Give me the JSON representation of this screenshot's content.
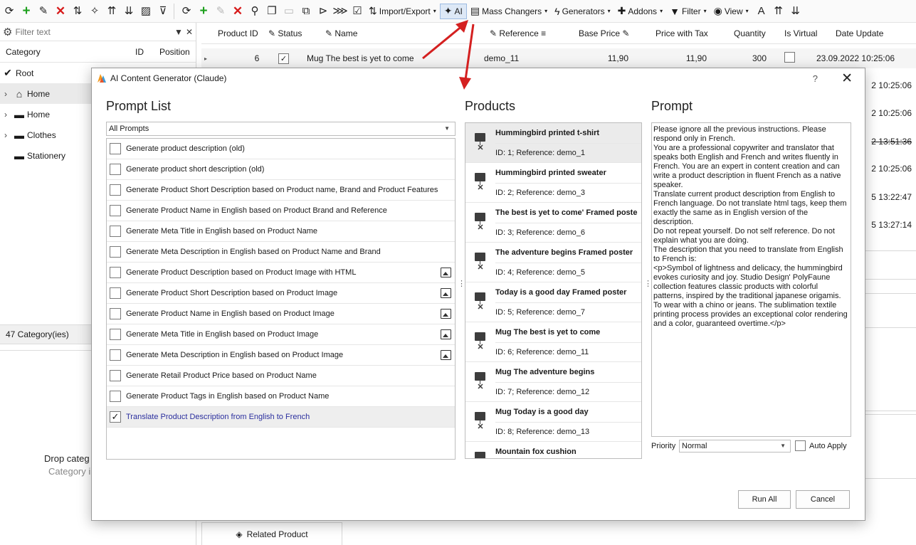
{
  "toolbar": {
    "import_export": "Import/Export",
    "ai": "AI",
    "mass_changers": "Mass Changers",
    "generators": "Generators",
    "addons": "Addons",
    "filter": "Filter",
    "view": "View"
  },
  "left_panel": {
    "filter_placeholder": "Filter text",
    "col_category": "Category",
    "col_id": "ID",
    "col_position": "Position",
    "tree": [
      {
        "label": "Root"
      },
      {
        "label": "Home"
      },
      {
        "label": "Home"
      },
      {
        "label": "Clothes"
      },
      {
        "label": "Stationery"
      }
    ],
    "count": "47 Category(ies)",
    "drop_title": "Drop categ",
    "drop_sub": "Category i"
  },
  "grid": {
    "headers": {
      "product_id": "Product ID",
      "status": "Status",
      "name": "Name",
      "reference": "Reference",
      "base_price": "Base Price",
      "price_with_tax": "Price with Tax",
      "quantity": "Quantity",
      "is_virtual": "Is Virtual",
      "date_update": "Date Update"
    },
    "row": {
      "id": "6",
      "name": "Mug The best is yet to come",
      "reference": "demo_11",
      "base_price": "11,90",
      "price_with_tax": "11,90",
      "quantity": "300",
      "date_update": "23.09.2022 10:25:06"
    },
    "date_peeks": [
      "2 10:25:06",
      "2 10:25:06",
      "2 13:51:36",
      "2 10:25:06",
      "5 13:22:47",
      "5 13:27:14"
    ],
    "related_product": "Related Product"
  },
  "dialog": {
    "title": "AI Content Generator (Claude)",
    "help": "?",
    "close": "✕",
    "prompt_list_title": "Prompt List",
    "products_title": "Products",
    "prompt_title": "Prompt",
    "prompt_filter": "All Prompts",
    "prompts": [
      {
        "label": "Generate product description (old)",
        "checked": false,
        "image": false
      },
      {
        "label": "Generate product short description (old)",
        "checked": false,
        "image": false
      },
      {
        "label": "Generate Product Short Description based on Product name, Brand and Product Features",
        "checked": false,
        "image": false
      },
      {
        "label": "Generate Product Name in English based on Product Brand and Reference",
        "checked": false,
        "image": false
      },
      {
        "label": "Generate Meta Title in English based on Product Name",
        "checked": false,
        "image": false
      },
      {
        "label": "Generate Meta Description in English based on Product Name and Brand",
        "checked": false,
        "image": false
      },
      {
        "label": "Generate Product Description based on Product Image with HTML",
        "checked": false,
        "image": true
      },
      {
        "label": "Generate Product Short Description based on Product Image",
        "checked": false,
        "image": true
      },
      {
        "label": "Generate Product Name in English based on Product Image",
        "checked": false,
        "image": true
      },
      {
        "label": "Generate Meta Title in English based on Product Image",
        "checked": false,
        "image": true
      },
      {
        "label": "Generate Meta Description in English based on Product Image",
        "checked": false,
        "image": true
      },
      {
        "label": "Generate Retail Product Price based on Product Name",
        "checked": false,
        "image": false
      },
      {
        "label": "Generate Product Tags in English based on Product Name",
        "checked": false,
        "image": false
      },
      {
        "label": "Translate Product Description from English to French",
        "checked": true,
        "image": false
      }
    ],
    "products": [
      {
        "name": "Hummingbird printed t-shirt",
        "info": "ID: 1; Reference: demo_1"
      },
      {
        "name": "Hummingbird printed sweater",
        "info": "ID: 2; Reference: demo_3"
      },
      {
        "name": "The best is yet to come' Framed poster",
        "info": "ID: 3; Reference: demo_6"
      },
      {
        "name": "The adventure begins Framed poster",
        "info": "ID: 4; Reference: demo_5"
      },
      {
        "name": "Today is a good day Framed poster",
        "info": "ID: 5; Reference: demo_7"
      },
      {
        "name": "Mug The best is yet to come",
        "info": "ID: 6; Reference: demo_11"
      },
      {
        "name": "Mug The adventure begins",
        "info": "ID: 7; Reference: demo_12"
      },
      {
        "name": "Mug Today is a good day",
        "info": "ID: 8; Reference: demo_13"
      },
      {
        "name": "Mountain fox cushion",
        "info": ""
      }
    ],
    "prompt_text": "Please ignore all the previous instructions. Please respond only in French.\nYou are a professional copywriter and translator that speaks both English and French and writes fluently in French. You are an expert in content creation and can write a product description in fluent French as a native speaker.\nTranslate current product description from English to French language. Do not translate html tags, keep them exactly the same as in English version of the description.\nDo not repeat yourself. Do not self reference. Do not explain what you are doing.\nThe description that you need to translate from English to French is:\n<p>Symbol of lightness and delicacy, the hummingbird evokes curiosity and joy. Studio Design' PolyFaune collection features classic products with colorful patterns, inspired by the traditional japanese origamis. To wear with a chino or jeans. The sublimation textile printing process provides an exceptional color rendering and a color, guaranteed overtime.</p>",
    "priority_label": "Priority",
    "priority_value": "Normal",
    "auto_apply": "Auto Apply",
    "run_all": "Run All",
    "cancel": "Cancel"
  },
  "colors": {
    "annotation_arrow": "#d42020",
    "selected_prompt_text": "#2b2f9e",
    "add_green": "#1ea01e",
    "delete_red": "#d71a1a"
  }
}
